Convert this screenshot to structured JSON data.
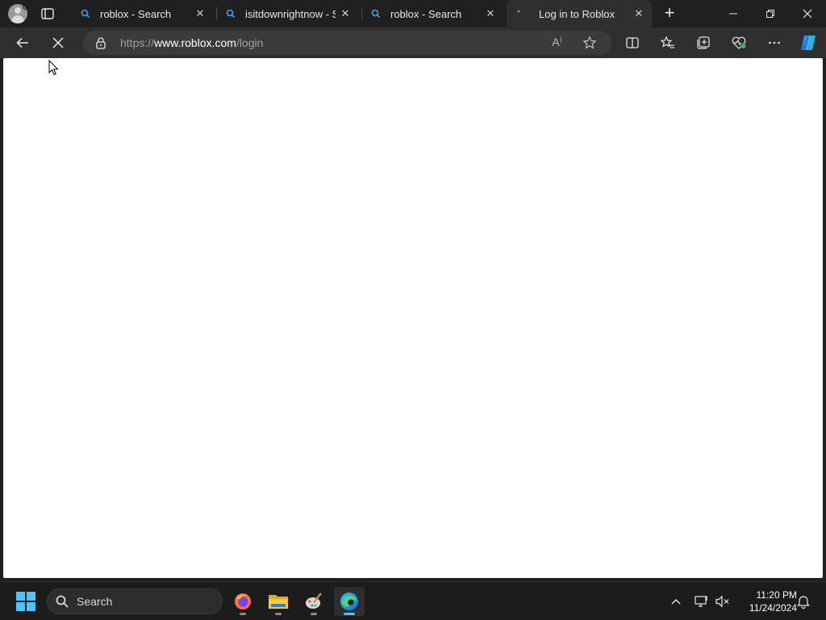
{
  "browser": {
    "tabs": [
      {
        "title": "roblox - Search",
        "close": "✕",
        "favicon": "search-favicon"
      },
      {
        "title": "isitdownrightnow - Sea",
        "close": "✕",
        "favicon": "search-favicon"
      },
      {
        "title": "roblox - Search",
        "close": "✕",
        "favicon": "search-favicon"
      },
      {
        "title": "Log in to Roblox",
        "close": "✕",
        "favicon": "loading-favicon",
        "active": true
      }
    ],
    "new_tab": "+",
    "window": {
      "minimize": "—",
      "restore": "❐",
      "close": "✕"
    },
    "address": {
      "scheme": "https://",
      "host": "www.roblox.com",
      "path": "/login"
    },
    "read_aloud": "A",
    "toolbar_icons": [
      "back-icon",
      "stop-loading-icon",
      "lock-icon",
      "read-aloud-icon",
      "favorite-star-icon",
      "split-screen-icon",
      "favorites-icon",
      "collections-icon",
      "browser-essentials-icon",
      "more-icon",
      "copilot-icon"
    ]
  },
  "taskbar": {
    "search_label": "Search",
    "apps": [
      "firefox-icon",
      "file-explorer-icon",
      "paint-icon",
      "edge-icon"
    ],
    "clock": {
      "time": "11:20 PM",
      "date": "11/24/2024"
    }
  },
  "colors": {
    "accent": "#4cc2ff",
    "chrome": "#202020",
    "toolbar": "#2f2f2f",
    "viewport": "#ffffff"
  }
}
